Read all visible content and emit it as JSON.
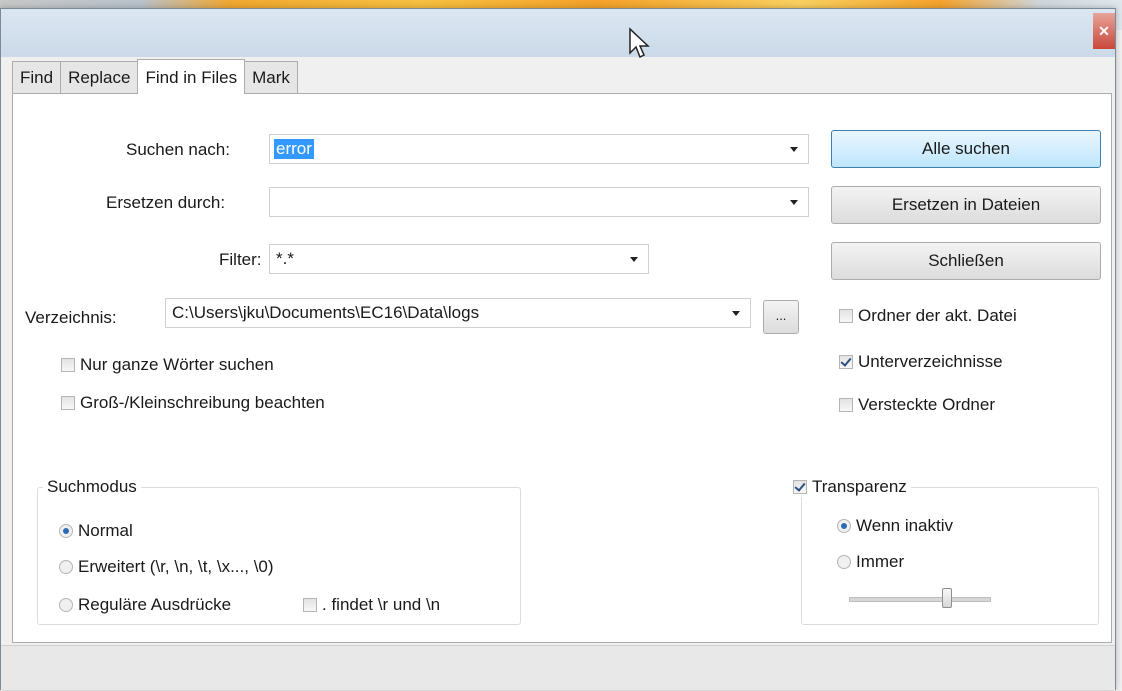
{
  "tabs": [
    "Find",
    "Replace",
    "Find in Files",
    "Mark"
  ],
  "active_tab": "Find in Files",
  "find": {
    "label": "Suchen nach:",
    "value": "error"
  },
  "replace": {
    "label": "Ersetzen durch:",
    "value": ""
  },
  "filter": {
    "label": "Filter:",
    "value": "*.*"
  },
  "directory": {
    "label": "Verzeichnis:",
    "value": "C:\\Users\\jku\\Documents\\EC16\\Data\\logs",
    "browse_label": "..."
  },
  "buttons": {
    "find_all": "Alle suchen",
    "replace_in_files": "Ersetzen in Dateien",
    "close": "Schließen"
  },
  "options": {
    "whole_words": {
      "label": "Nur ganze Wörter suchen",
      "checked": false
    },
    "match_case": {
      "label": "Groß-/Kleinschreibung beachten",
      "checked": false
    },
    "current_folder": {
      "label": "Ordner der akt. Datei",
      "checked": false
    },
    "subfolders": {
      "label": "Unterverzeichnisse",
      "checked": true
    },
    "hidden_folders": {
      "label": "Versteckte Ordner",
      "checked": false
    }
  },
  "search_mode": {
    "title": "Suchmodus",
    "normal": "Normal",
    "extended": "Erweitert (\\r, \\n, \\t, \\x..., \\0)",
    "regex": "Reguläre Ausdrücke",
    "dot_newline": ". findet \\r und \\n",
    "selected": "normal"
  },
  "transparency": {
    "label": "Transparenz",
    "checked": true,
    "when_inactive": "Wenn inaktiv",
    "always": "Immer",
    "selected": "when_inactive",
    "level": 0.7
  }
}
